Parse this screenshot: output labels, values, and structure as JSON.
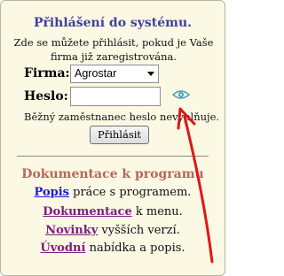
{
  "login": {
    "title": "Přihlášení do systému.",
    "info": "Zde se můžete přihlásit, pokud je Vaše firma již zaregistrována.",
    "firma_label": "Firma:",
    "firma_value": "Agrostar",
    "heslo_label": "Heslo:",
    "heslo_value": "",
    "employee_note": "Běžný zaměstnanec heslo nevyplňuje.",
    "submit_label": "Přihlásit"
  },
  "docs": {
    "title": "Dokumentace k programu",
    "items": [
      {
        "link": "Popis",
        "text": " práce s programem.",
        "color": "#1a1ad8"
      },
      {
        "link": "Dokumentace",
        "text": " k menu.",
        "color": "#7a1e82"
      },
      {
        "link": "Novinky",
        "text": " vyšších verzí.",
        "color": "#7a1e82"
      },
      {
        "link": "Úvodní",
        "text": " nabídka a popis.",
        "color": "#7a1e82"
      }
    ]
  },
  "colors": {
    "panel_bg": "#fbf8e4",
    "login_title": "#3f3f9e",
    "docs_title": "#b9655a",
    "arrow": "#e01616",
    "eye": "#3aa0b4"
  },
  "icons": {
    "password_toggle": "eye-icon",
    "select_caret": "chevron-down-icon"
  }
}
